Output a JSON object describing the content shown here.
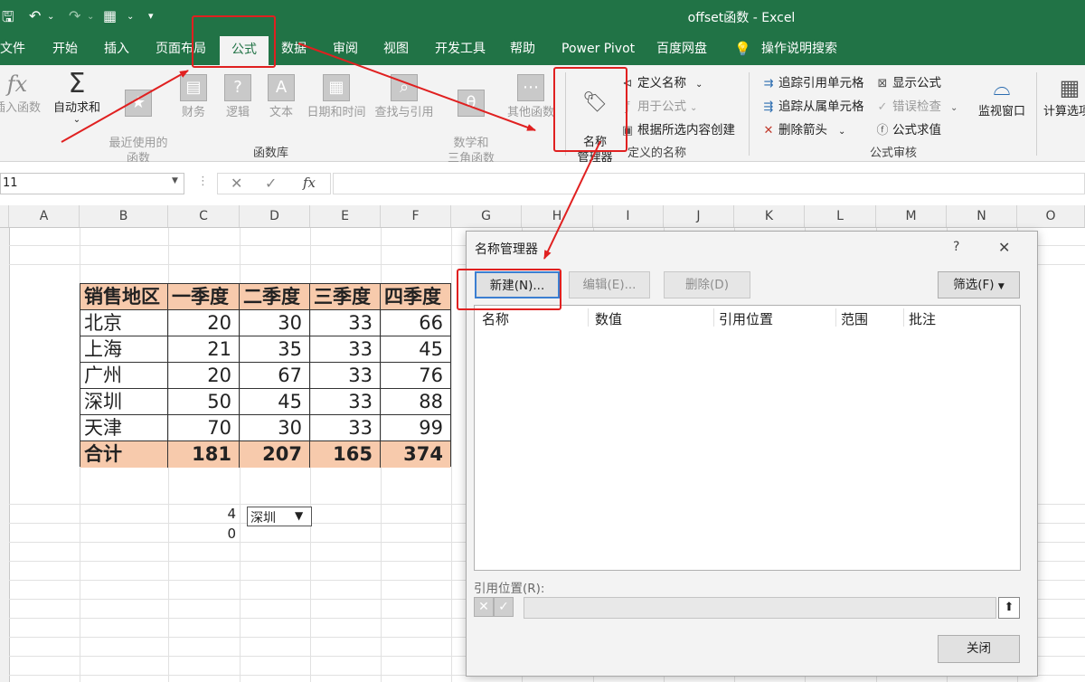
{
  "titlebar": {
    "title": "offset函数 - Excel",
    "qat_icons": [
      "save-icon",
      "undo-icon",
      "redo-icon",
      "touch-mode-icon",
      "customize-qat-icon"
    ]
  },
  "tabs": [
    "文件",
    "开始",
    "插入",
    "页面布局",
    "公式",
    "数据",
    "审阅",
    "视图",
    "开发工具",
    "帮助",
    "Power Pivot",
    "百度网盘",
    "操作说明搜索"
  ],
  "active_tab": "公式",
  "ribbon": {
    "function_library": {
      "label": "函数库",
      "buttons": [
        "插入函数",
        "自动求和",
        "最近使用的\n函数",
        "财务",
        "逻辑",
        "文本",
        "日期和时间",
        "查找与引用",
        "数学和\n三角函数",
        "其他函数"
      ]
    },
    "defined_names": {
      "label": "定义的名称",
      "name_manager": "名称\n管理器",
      "define_name": "定义名称",
      "use_in_formula": "用于公式",
      "create_from_selection": "根据所选内容创建"
    },
    "formula_auditing": {
      "label": "公式审核",
      "trace_precedents": "追踪引用单元格",
      "trace_dependents": "追踪从属单元格",
      "remove_arrows": "删除箭头",
      "show_formulas": "显示公式",
      "error_checking": "错误检查",
      "evaluate_formula": "公式求值"
    },
    "watch_window": "监视窗口",
    "calculation": "计算选项"
  },
  "formula_bar": {
    "name_box": "11",
    "fx": "fx",
    "value": ""
  },
  "columns": [
    "A",
    "B",
    "C",
    "D",
    "E",
    "F",
    "G",
    "H",
    "I",
    "J",
    "K",
    "L",
    "M",
    "N",
    "O"
  ],
  "table": {
    "headers": [
      "销售地区",
      "一季度",
      "二季度",
      "三季度",
      "四季度"
    ],
    "rows": [
      [
        "北京",
        "20",
        "30",
        "33",
        "66"
      ],
      [
        "上海",
        "21",
        "35",
        "33",
        "45"
      ],
      [
        "广州",
        "20",
        "67",
        "33",
        "76"
      ],
      [
        "深圳",
        "50",
        "45",
        "33",
        "88"
      ],
      [
        "天津",
        "70",
        "30",
        "33",
        "99"
      ]
    ],
    "total": [
      "合计",
      "181",
      "207",
      "165",
      "374"
    ]
  },
  "extra": {
    "c_value_1": "4",
    "c_value_2": "0",
    "dropdown_value": "深圳"
  },
  "dialog": {
    "title": "名称管理器",
    "help": "?",
    "close": "✕",
    "new_btn": "新建(N)...",
    "edit_btn": "编辑(E)...",
    "delete_btn": "删除(D)",
    "filter_btn": "筛选(F)",
    "list_headers": [
      "名称",
      "数值",
      "引用位置",
      "范围",
      "批注"
    ],
    "refers_to_label": "引用位置(R):",
    "refers_to_value": "",
    "close_btn": "关闭"
  },
  "colors": {
    "excel_green": "#217346",
    "header_fill": "#f7caac",
    "highlight_red": "#e02020"
  }
}
